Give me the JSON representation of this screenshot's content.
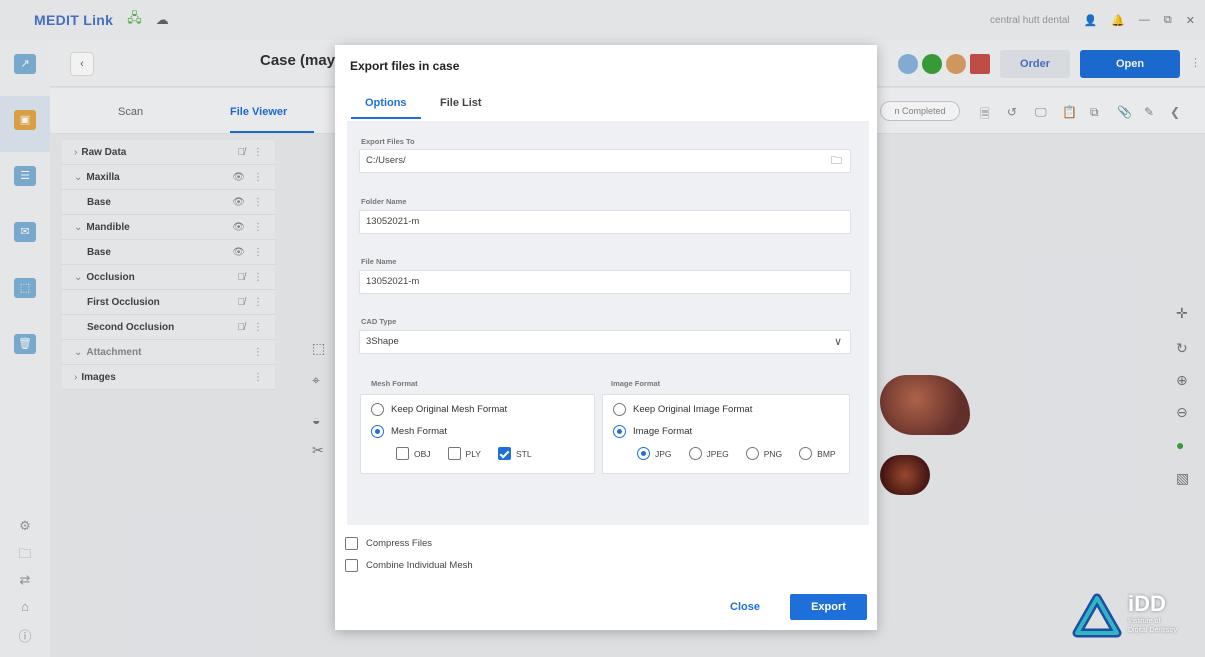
{
  "app": {
    "title": "MEDIT Link",
    "user": "central hutt dental"
  },
  "header": {
    "case_title": "Case (may",
    "order_label": "Order",
    "open_label": "Open",
    "status_label": "n Completed"
  },
  "subnav": {
    "tab_scan": "Scan",
    "tab_fileviewer": "File Viewer"
  },
  "tree": [
    {
      "label": "Raw Data",
      "prefix": ">",
      "child": false,
      "eye": "hidden",
      "muted": false
    },
    {
      "label": "Maxilla",
      "prefix": "v",
      "child": false,
      "eye": "visible",
      "muted": false
    },
    {
      "label": "Base",
      "prefix": "",
      "child": true,
      "eye": "visible",
      "muted": false
    },
    {
      "label": "Mandible",
      "prefix": "v",
      "child": false,
      "eye": "visible",
      "muted": false
    },
    {
      "label": "Base",
      "prefix": "",
      "child": true,
      "eye": "visible",
      "muted": false
    },
    {
      "label": "Occlusion",
      "prefix": "v",
      "child": false,
      "eye": "hidden",
      "muted": false
    },
    {
      "label": "First Occlusion",
      "prefix": "",
      "child": true,
      "eye": "hidden",
      "muted": false
    },
    {
      "label": "Second Occlusion",
      "prefix": "",
      "child": true,
      "eye": "hidden",
      "muted": false
    },
    {
      "label": "Attachment",
      "prefix": "v",
      "child": false,
      "eye": "",
      "muted": true
    },
    {
      "label": "Images",
      "prefix": ">",
      "child": false,
      "eye": "",
      "muted": false
    }
  ],
  "dialog": {
    "title": "Export files in case",
    "tab_options": "Options",
    "tab_filelist": "File List",
    "export_to_label": "Export Files To",
    "export_to_value": "C:/Users/",
    "folder_name_label": "Folder Name",
    "folder_name_value": "13052021-m",
    "file_name_label": "File Name",
    "file_name_value": "13052021-m",
    "cad_type_label": "CAD Type",
    "cad_type_value": "3Shape",
    "mesh_format_label": "Mesh Format",
    "mesh_keep_label": "Keep Original Mesh Format",
    "mesh_format_option": "Mesh Format",
    "mesh_obj": "OBJ",
    "mesh_ply": "PLY",
    "mesh_stl": "STL",
    "image_format_label": "Image Format",
    "image_keep_label": "Keep Original Image Format",
    "image_format_option": "Image Format",
    "img_jpg": "JPG",
    "img_jpeg": "JPEG",
    "img_png": "PNG",
    "img_bmp": "BMP",
    "compress_label": "Compress Files",
    "combine_label": "Combine Individual Mesh",
    "close_label": "Close",
    "export_label": "Export"
  },
  "watermark": {
    "logo": "iDD",
    "line1": "Institute of",
    "line2": "Digital Dentistry"
  },
  "colors": {
    "accent": "#1e6fd9",
    "title_blue": "#4a74c9",
    "brand_green": "#56b04b"
  }
}
